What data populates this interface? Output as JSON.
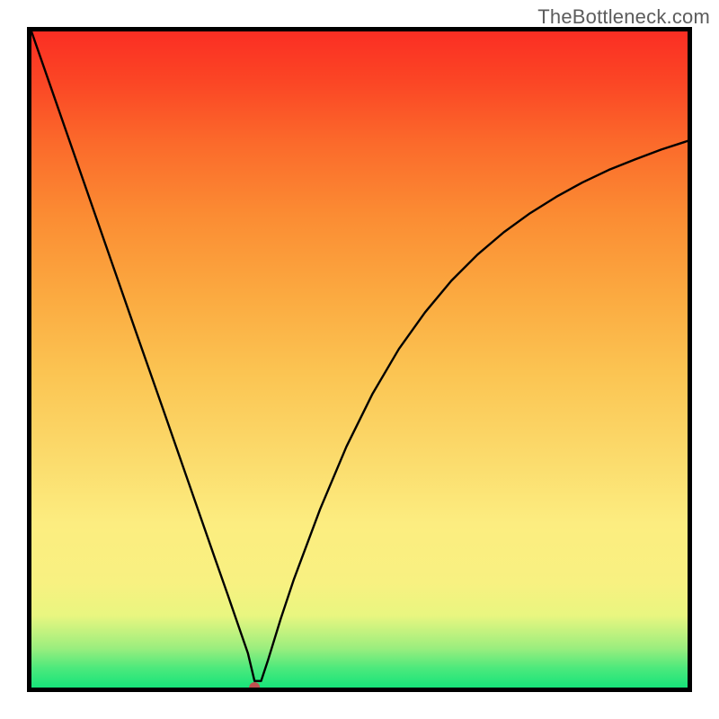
{
  "watermark": "TheBottleneck.com",
  "chart_data": {
    "type": "line",
    "title": "",
    "xlabel": "",
    "ylabel": "",
    "xlim": [
      0,
      100
    ],
    "ylim": [
      0,
      100
    ],
    "grid": false,
    "legend": false,
    "minimum_marker": {
      "x": 34,
      "y": 0,
      "color": "#c05050",
      "radius": 6
    },
    "series": [
      {
        "name": "curve",
        "color": "#000000",
        "x": [
          0,
          4,
          8,
          12,
          16,
          20,
          24,
          28,
          30,
          32,
          33,
          34,
          35,
          36,
          38,
          40,
          44,
          48,
          52,
          56,
          60,
          64,
          68,
          72,
          76,
          80,
          84,
          88,
          92,
          96,
          100
        ],
        "values": [
          100,
          88.5,
          77,
          65.5,
          54,
          42.6,
          31.1,
          19.6,
          13.9,
          8.1,
          5.2,
          1.0,
          1.0,
          4.0,
          10.5,
          16.5,
          27.2,
          36.7,
          44.8,
          51.6,
          57.2,
          62.0,
          66.0,
          69.4,
          72.3,
          74.8,
          77.0,
          78.9,
          80.5,
          82.0,
          83.3
        ]
      }
    ]
  }
}
